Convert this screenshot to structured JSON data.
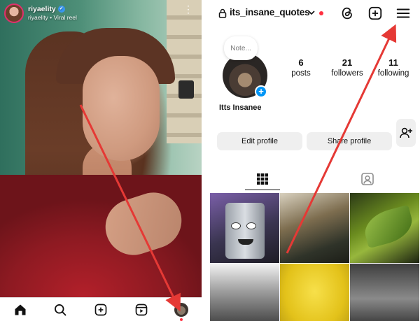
{
  "reel": {
    "username": "riyaelity",
    "subtitle": "riyaelity • Viral reel",
    "verified_icon": "✓"
  },
  "bottom_nav": {
    "items": [
      "home-icon",
      "search-icon",
      "create-icon",
      "reels-icon",
      "profile-avatar"
    ]
  },
  "profile": {
    "username": "its_insane_quotes",
    "note_placeholder": "Note...",
    "display_name": "Itts Insanee",
    "stats": [
      {
        "value": "6",
        "label": "posts"
      },
      {
        "value": "21",
        "label": "followers"
      },
      {
        "value": "11",
        "label": "following"
      }
    ],
    "edit_button": "Edit profile",
    "share_button": "Share profile",
    "add_story_symbol": "+"
  },
  "tabs": {
    "items": [
      "grid-icon",
      "tagged-icon"
    ],
    "active": "grid-icon"
  },
  "colors": {
    "notification": "#ff3040",
    "accent_blue": "#0095f6",
    "button_bg": "#efefef",
    "annotation_arrow": "#e53935"
  }
}
